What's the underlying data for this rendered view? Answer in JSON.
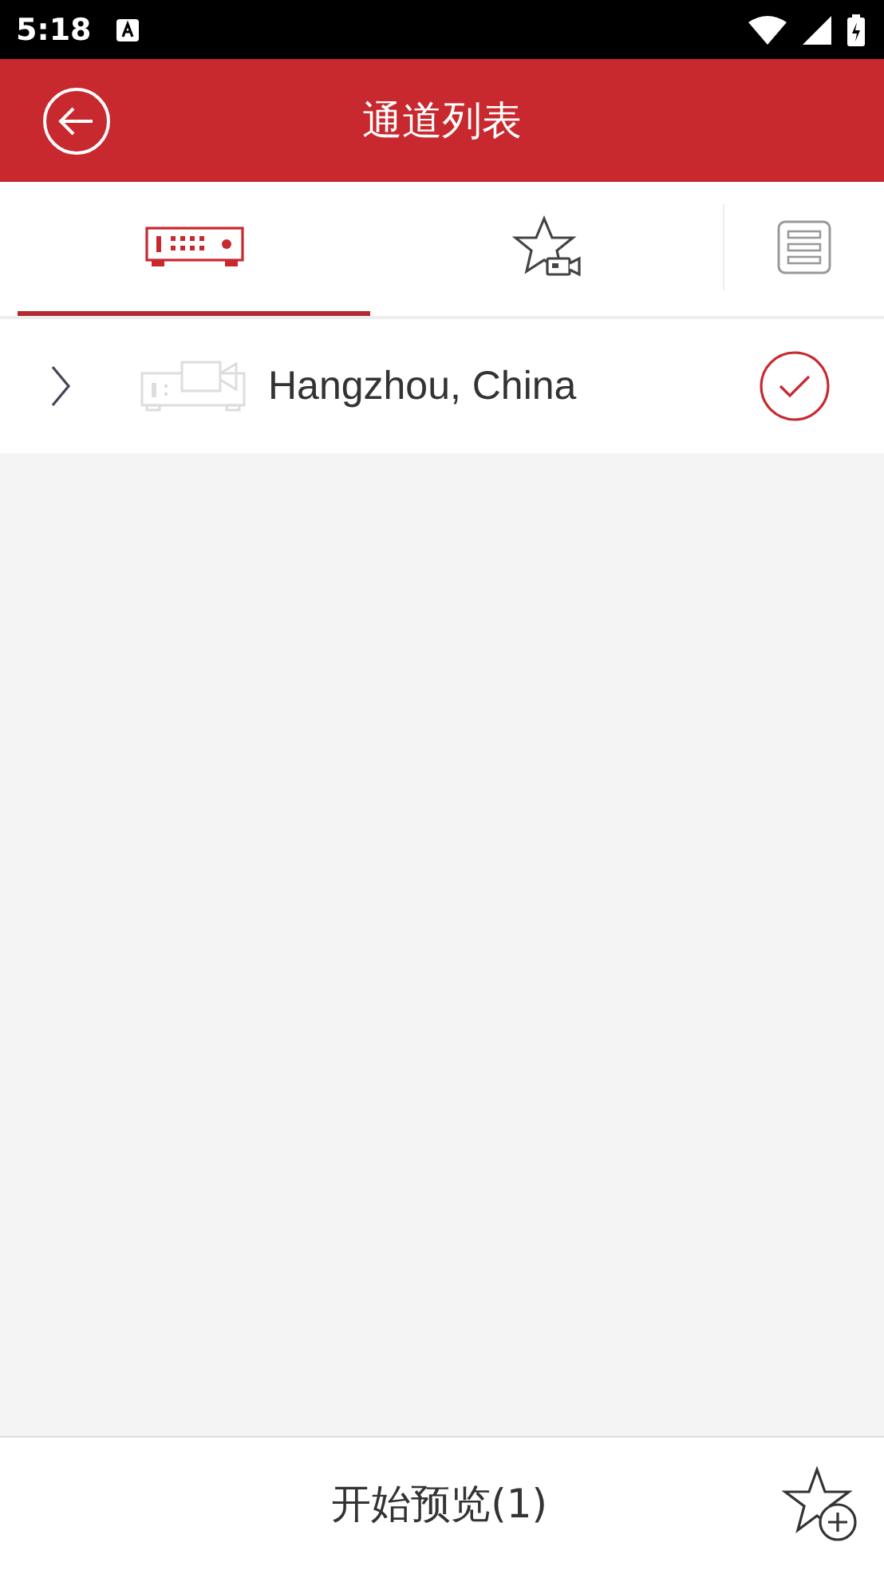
{
  "status_bar": {
    "time": "5:18"
  },
  "header": {
    "title": "通道列表"
  },
  "tabs": [
    {
      "kind": "device",
      "selected": true
    },
    {
      "kind": "favorite",
      "selected": false
    }
  ],
  "rows": [
    {
      "name": "Hangzhou, China",
      "expanded": false,
      "checked": true
    }
  ],
  "footer": {
    "button": "开始预览(1)"
  }
}
